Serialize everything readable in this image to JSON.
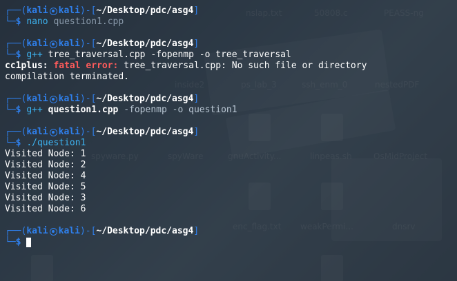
{
  "prompt": {
    "user": "kali",
    "host": "kali",
    "path": "~/Desktop/pdc/asg4",
    "symbol": "$"
  },
  "desktop_labels": [
    "nslap.txt",
    "50808.c",
    "PEASS-ng",
    "inside2",
    "ps_lab_3",
    "ssh_enm_0",
    "nestedPDF",
    "spyware.py",
    "spyWare",
    "gnuActivity...",
    "linpeas.sh",
    "OsMidProject",
    "enc_flag.txt",
    "weakPermi...",
    "dnsrv"
  ],
  "blocks": [
    {
      "command": {
        "program": "nano",
        "args": "question1.cpp"
      },
      "output": []
    },
    {
      "command": {
        "program": "g++",
        "args": "tree_traversal.cpp -fopenmp -o tree_traversal"
      },
      "output": [
        {
          "prefix": "cc1plus:",
          "fatal": "fatal error:",
          "message": "tree_traversal.cpp: No such file or directory"
        },
        {
          "text": "compilation terminated."
        }
      ]
    },
    {
      "command": {
        "program": "g++",
        "file": "question1.cpp",
        "args": "-fopenmp -o question1"
      },
      "output": []
    },
    {
      "command": {
        "program": "./question1",
        "args": ""
      },
      "output": [
        {
          "text": "Visited Node: 1"
        },
        {
          "text": "Visited Node: 2"
        },
        {
          "text": "Visited Node: 4"
        },
        {
          "text": "Visited Node: 5"
        },
        {
          "text": "Visited Node: 3"
        },
        {
          "text": "Visited Node: 6"
        }
      ]
    }
  ]
}
